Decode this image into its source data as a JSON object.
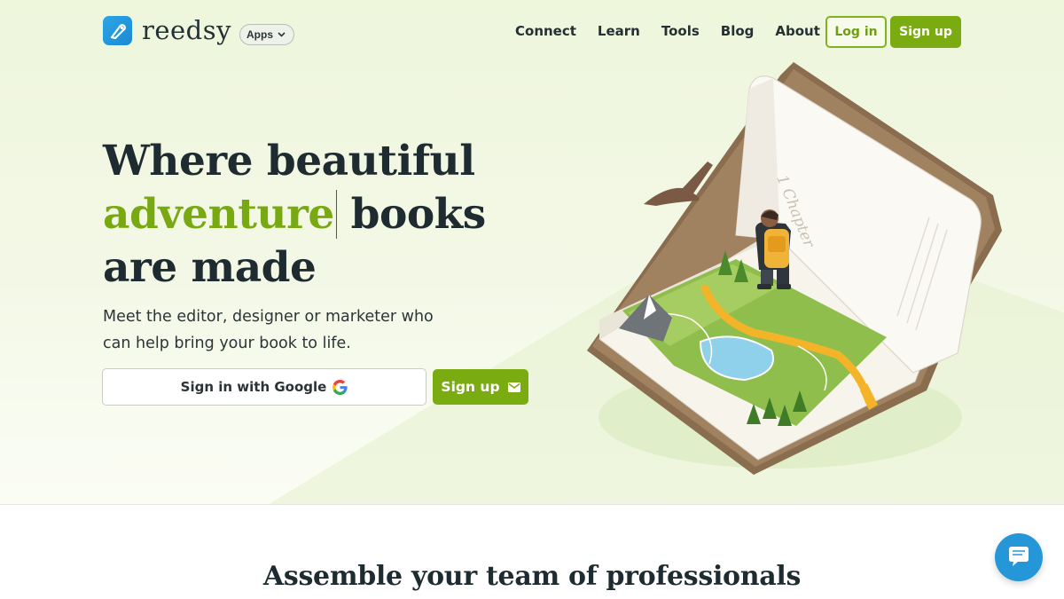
{
  "logo": {
    "text": "reedsy"
  },
  "nav": {
    "apps_label": "Apps",
    "links": [
      "Connect",
      "Learn",
      "Tools",
      "Blog",
      "About"
    ],
    "login_label": "Log in",
    "signup_label": "Sign up"
  },
  "hero": {
    "headline_line1": "Where beautiful",
    "headline_accent": "adventure",
    "headline_line2_rest": " books",
    "headline_line3": "are made",
    "subhead": "Meet the editor, designer or marketer who can help bring your book to life.",
    "google_button_label": "Sign in with Google",
    "signup_button_label": "Sign up",
    "book_page_text": "1 Chapter"
  },
  "section": {
    "title": "Assemble your team of professionals"
  },
  "colors": {
    "accent": "#7aac12",
    "brand_blue": "#2597d8",
    "text": "#1e2b30"
  },
  "icons": [
    "reedsy-logo-icon",
    "chevron-down-icon",
    "google-icon",
    "envelope-icon",
    "chat-icon"
  ]
}
